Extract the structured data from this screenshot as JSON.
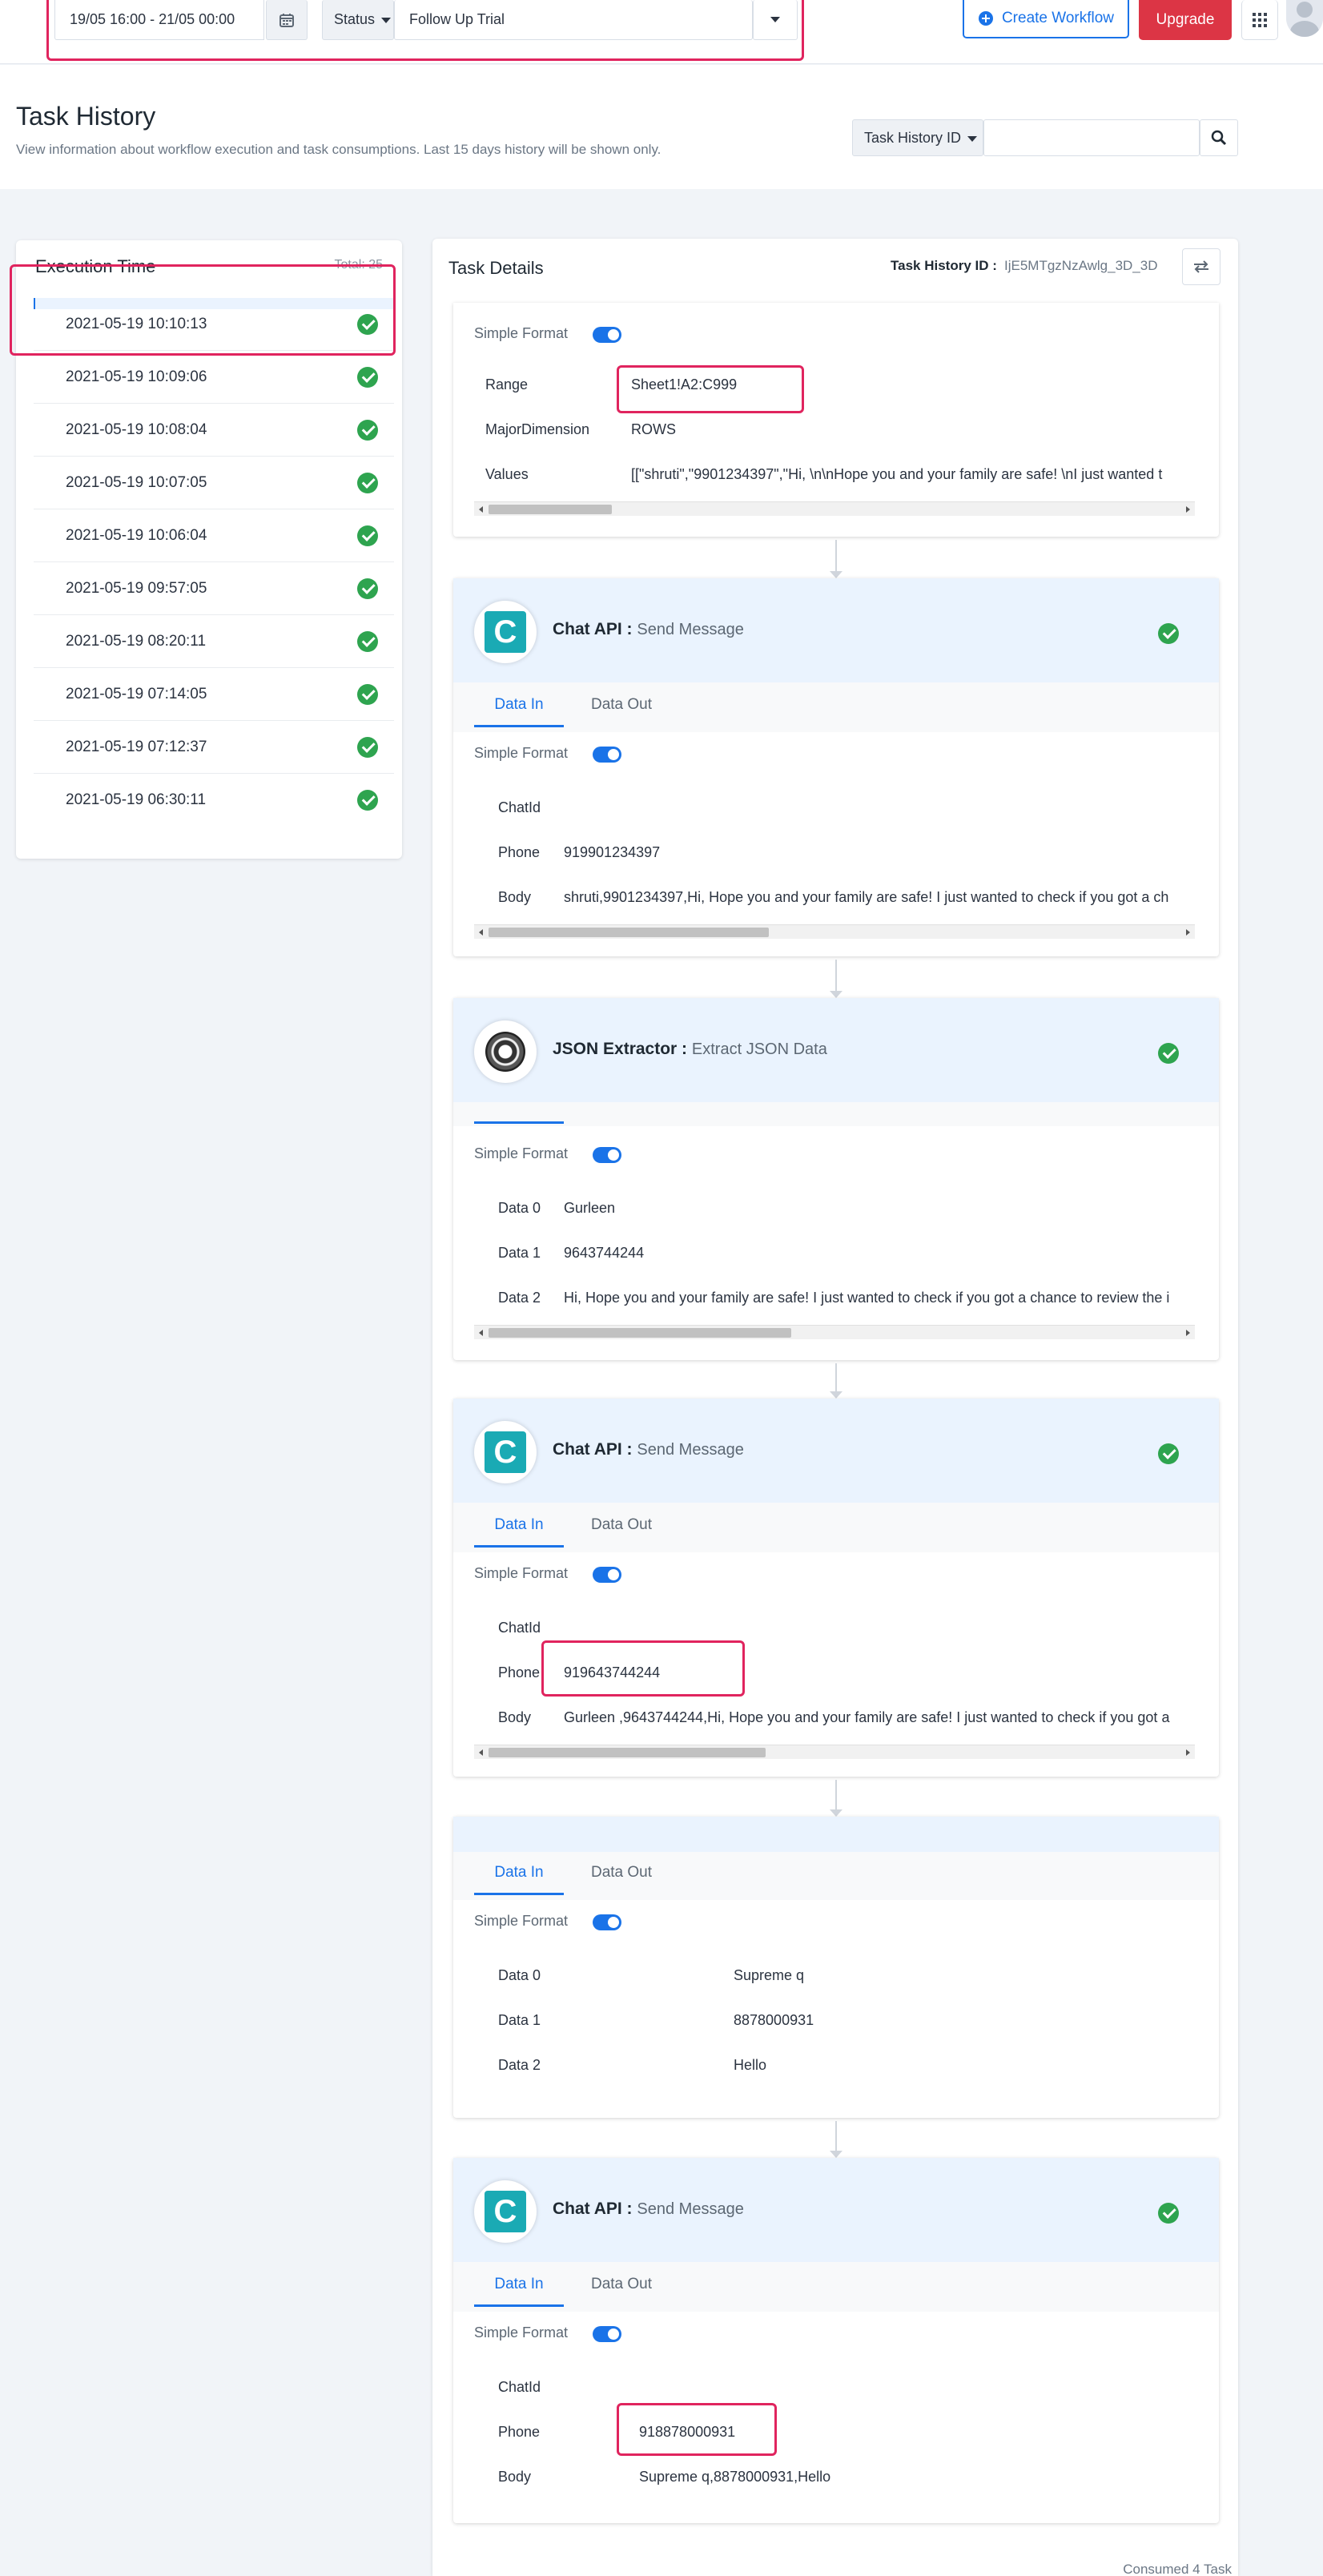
{
  "filters": {
    "date_range": "19/05 16:00 - 21/05 00:00",
    "status_label": "Status",
    "workflow_value": "Follow Up Trial"
  },
  "top_actions": {
    "create_workflow": "Create Workflow",
    "upgrade": "Upgrade"
  },
  "header": {
    "title": "Task History",
    "subtitle": "View information about workflow execution and task consumptions. Last 15 days history will be shown only.",
    "search_type": "Task History ID",
    "search_value": ""
  },
  "execution": {
    "title": "Execution Time",
    "total": "Total: 25",
    "rows": [
      "2021-05-19 10:10:13",
      "2021-05-19 10:09:06",
      "2021-05-19 10:08:04",
      "2021-05-19 10:07:05",
      "2021-05-19 10:06:04",
      "2021-05-19 09:57:05",
      "2021-05-19 08:20:11",
      "2021-05-19 07:14:05",
      "2021-05-19 07:12:37",
      "2021-05-19 06:30:11"
    ]
  },
  "task_details": {
    "title": "Task Details",
    "history_id_label": "Task History ID :",
    "history_id": "IjE5MTgzNzAwlg_3D_3D",
    "consumed": "Consumed 4 Task",
    "tab_in": "Data In",
    "tab_out": "Data Out",
    "simple_format": "Simple Format",
    "card1": {
      "range_key": "Range",
      "range_val": "Sheet1!A2:C999",
      "dim_key": "MajorDimension",
      "dim_val": "ROWS",
      "values_key": "Values",
      "values_val": "[[\"shruti\",\"9901234397\",\"Hi, \\n\\nHope you and your family are safe! \\nI just wanted t"
    },
    "card2": {
      "app": "Chat API :",
      "action": "Send Message",
      "chatid_key": "ChatId",
      "phone_key": "Phone",
      "phone_val": "919901234397",
      "body_key": "Body",
      "body_val": "shruti,9901234397,Hi, Hope you and your family are safe! I just wanted to check if you got a ch"
    },
    "card3": {
      "app": "JSON Extractor :",
      "action": "Extract JSON Data",
      "d0_key": "Data 0",
      "d0_val": "Gurleen",
      "d1_key": "Data 1",
      "d1_val": "9643744244",
      "d2_key": "Data 2",
      "d2_val": "Hi, Hope you and your family are safe! I just wanted to check if you got a chance to review the i"
    },
    "card4": {
      "app": "Chat API :",
      "action": "Send Message",
      "chatid_key": "ChatId",
      "phone_key": "Phone",
      "phone_val": "919643744244",
      "body_key": "Body",
      "body_val": "Gurleen ,9643744244,Hi, Hope you and your family are safe! I just wanted to check if you got a"
    },
    "card5": {
      "d0_key": "Data 0",
      "d0_val": "Supreme q",
      "d1_key": "Data 1",
      "d1_val": "8878000931",
      "d2_key": "Data 2",
      "d2_val": "Hello"
    },
    "card6": {
      "app": "Chat API :",
      "action": "Send Message",
      "chatid_key": "ChatId",
      "phone_key": "Phone",
      "phone_val": "918878000931",
      "body_key": "Body",
      "body_val": "Supreme q,8878000931,Hello"
    }
  },
  "colors": {
    "accent": "#1a73e8",
    "upgrade": "#dc3545",
    "highlight": "#e0245e",
    "success": "#2ea44f"
  }
}
